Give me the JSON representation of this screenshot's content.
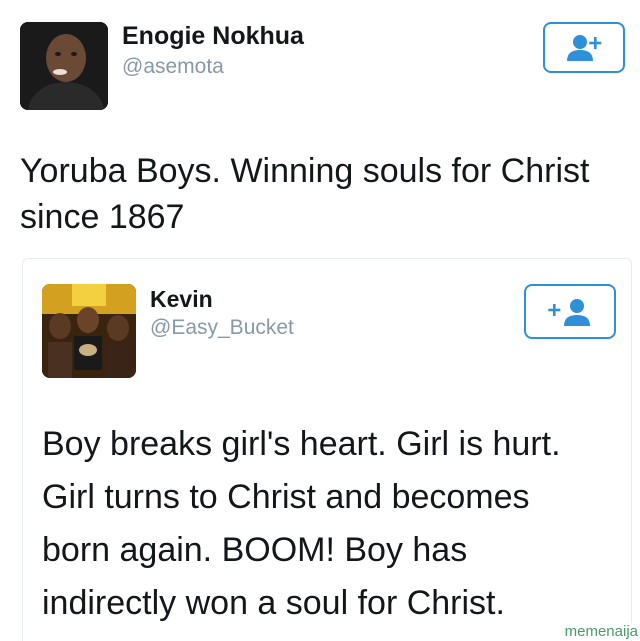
{
  "outer_tweet": {
    "name": "Enogie Nokhua",
    "handle": "@asemota",
    "text_line1": "Yoruba Boys. Winning souls for Christ",
    "text_line2": "since 1867",
    "follow_icon": "add-user-icon"
  },
  "quoted_tweet": {
    "name": "Kevin",
    "handle": "@Easy_Bucket",
    "text_lines": [
      "Boy breaks girl's heart. Girl is hurt.",
      "Girl turns to Christ and becomes",
      "born again. BOOM!  Boy has",
      "indirectly won a soul for Christ."
    ],
    "follow_icon": "add-user-icon"
  },
  "watermark": "memenaija",
  "colors": {
    "accent": "#2f8fd8",
    "handle": "#8899a6",
    "text": "#14171a"
  }
}
